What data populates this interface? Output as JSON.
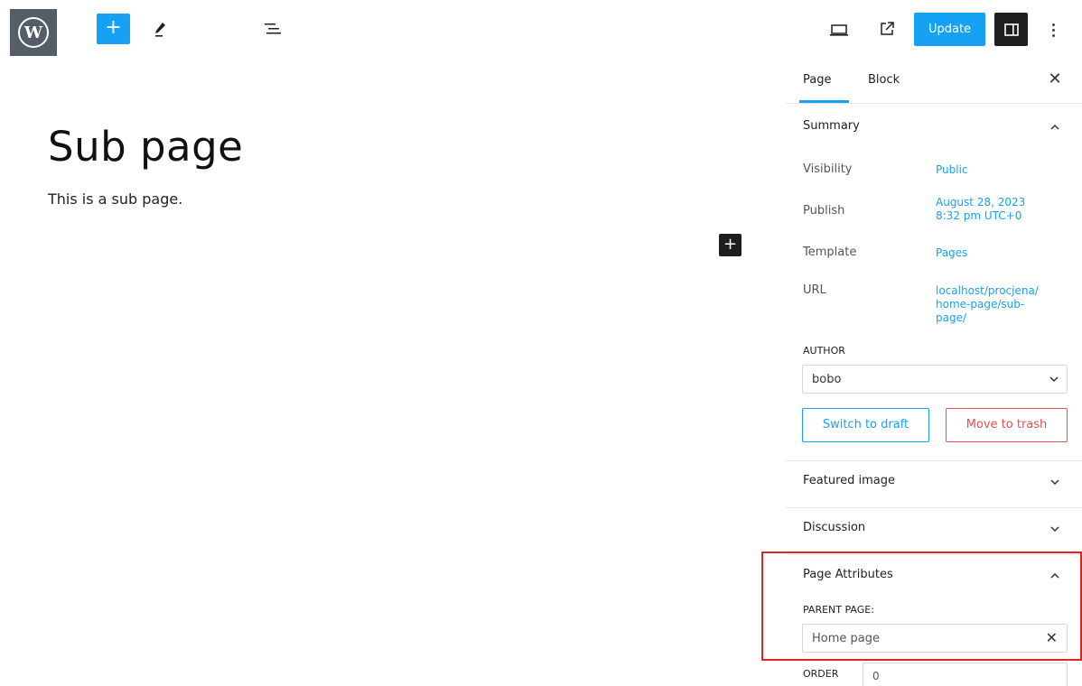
{
  "toolbar": {
    "logo_letter": "W",
    "add_label": "+",
    "update_label": "Update"
  },
  "editor": {
    "title": "Sub page",
    "body": "This is a sub page.",
    "inserter_label": "+"
  },
  "sidebar": {
    "tabs": [
      {
        "label": "Page",
        "active": true
      },
      {
        "label": "Block",
        "active": false
      }
    ],
    "close_label": "✕",
    "summary": {
      "title": "Summary",
      "rows": [
        {
          "label": "Visibility",
          "value": "Public"
        },
        {
          "label": "Publish",
          "value_line1": "August 28, 2023",
          "value_line2": "8:32 pm UTC+0"
        },
        {
          "label": "Template",
          "value": "Pages"
        },
        {
          "label": "URL",
          "value_line1": "localhost/procjena/",
          "value_line2": "home-page/sub-",
          "value_line3": "page/"
        }
      ],
      "author_label": "AUTHOR",
      "author_value": "bobo",
      "switch_draft_label": "Switch to draft",
      "move_trash_label": "Move to trash"
    },
    "featured_image_title": "Featured image",
    "discussion_title": "Discussion",
    "page_attributes": {
      "title": "Page Attributes",
      "parent_label": "PARENT PAGE:",
      "parent_value": "Home page",
      "clear_label": "✕",
      "order_label": "ORDER",
      "order_value": "0"
    }
  },
  "colors": {
    "accent": "#16a1f4",
    "danger": "#e65054",
    "highlight": "#e02424"
  }
}
